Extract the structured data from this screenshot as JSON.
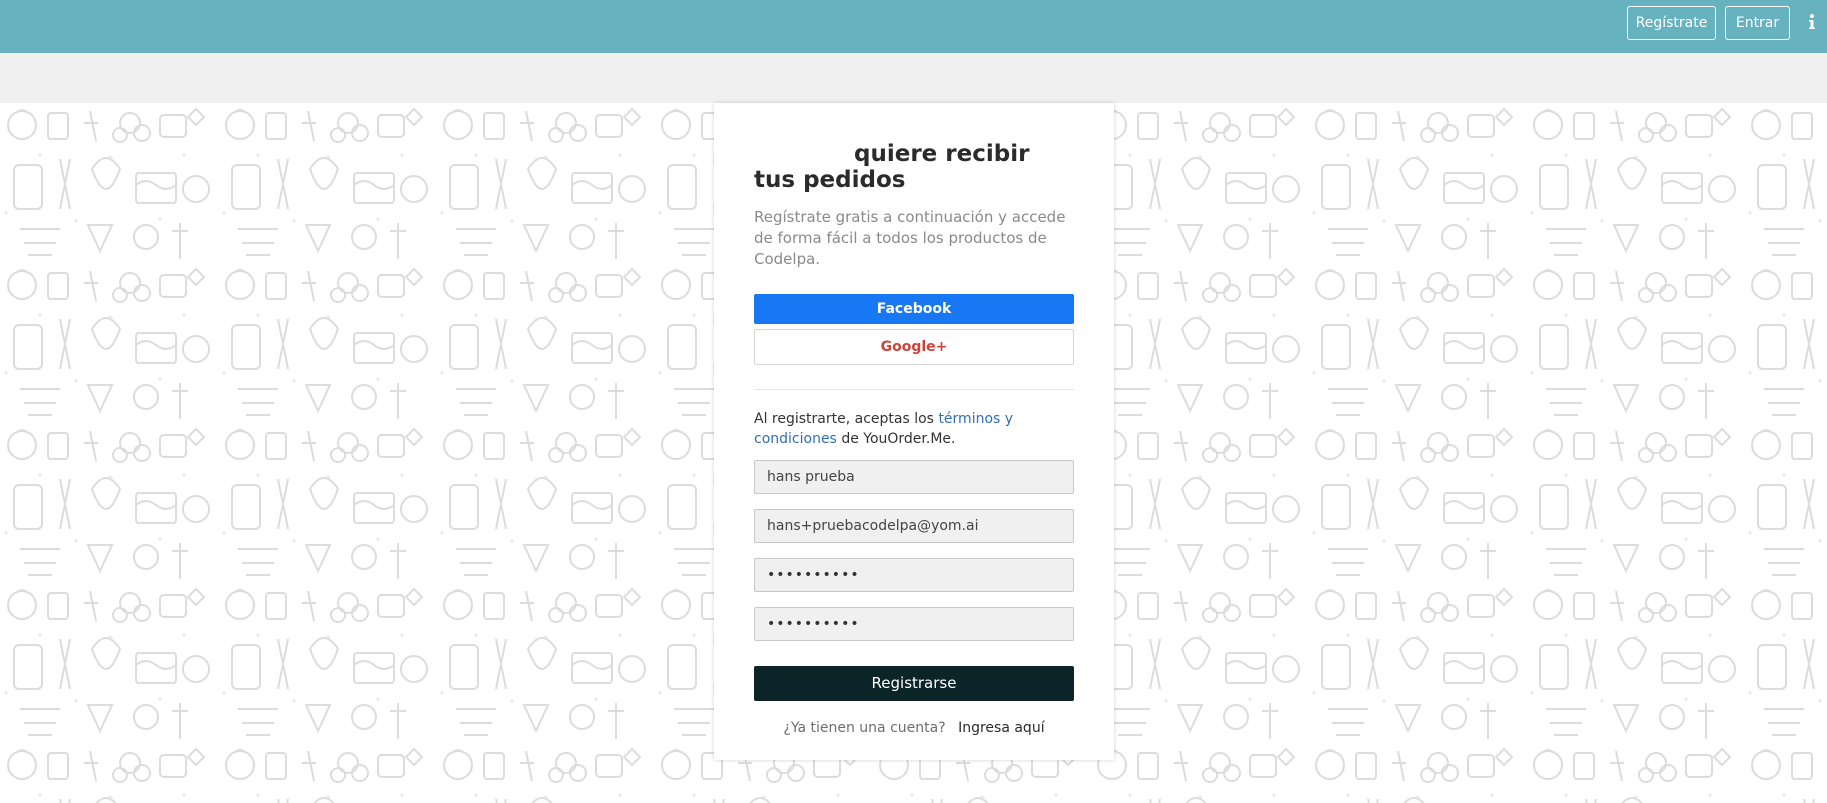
{
  "topbar": {
    "register_label": "Regístrate",
    "login_label": "Entrar",
    "bg_color": "#66b2bf"
  },
  "card": {
    "title": "quiere recibir tus pedidos",
    "subtitle": "Regístrate gratis a continuación y accede de forma fácil a todos los productos de Codelpa.",
    "facebook_label": "Facebook",
    "google_label": "Google+",
    "terms_prefix": "Al registrarte, aceptas los",
    "terms_link": "términos y condiciones",
    "terms_suffix": "de YouOrder.Me.",
    "fields": {
      "name": "hans prueba",
      "email": "hans+pruebacodelpa@yom.ai",
      "password": "••••••••••",
      "password_confirm": "••••••••••"
    },
    "submit_label": "Registrarse",
    "login_question": "¿Ya tienen una cuenta?",
    "login_link": "Ingresa aquí"
  },
  "colors": {
    "facebook": "#1877f2",
    "google": "#d0413b",
    "submit": "#0b2428",
    "link": "#2f6fb0"
  }
}
